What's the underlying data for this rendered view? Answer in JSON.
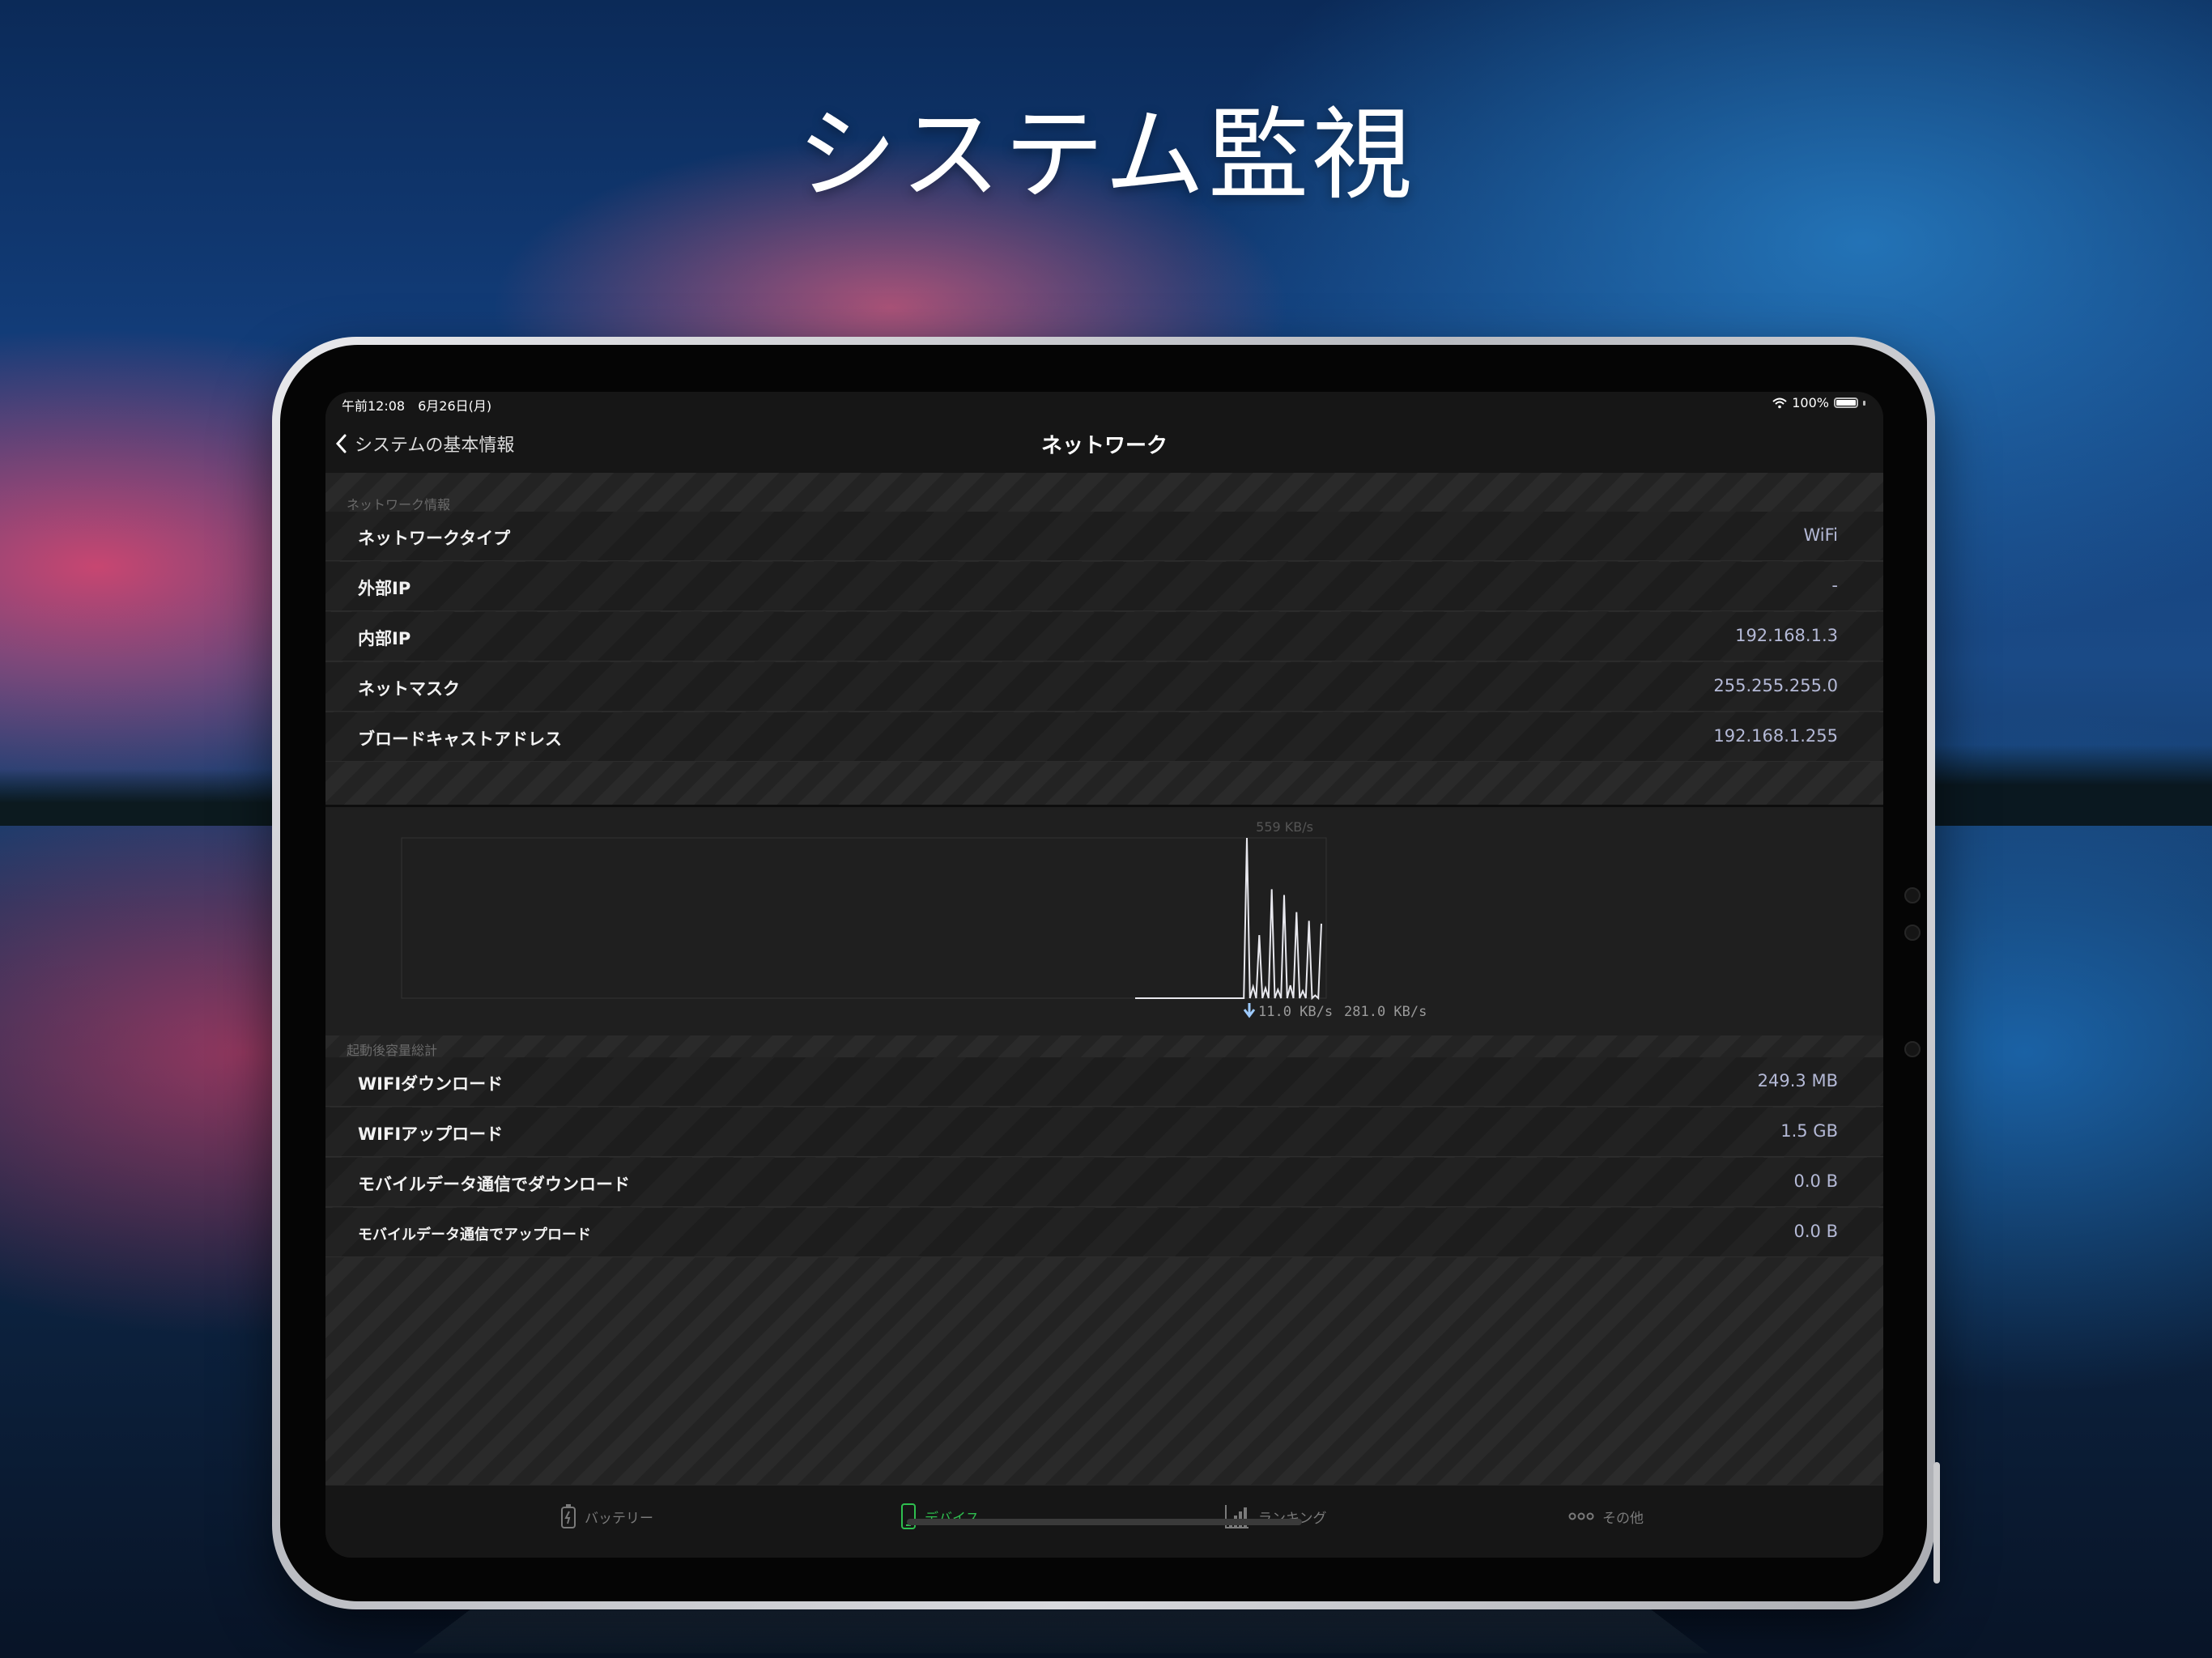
{
  "hero": {
    "title": "システム監視"
  },
  "status_bar": {
    "time": "午前12:08　6月26日(月)",
    "battery": "100%"
  },
  "nav": {
    "back_label": "システムの基本情報",
    "title": "ネットワーク"
  },
  "network_info": {
    "header": "ネットワーク情報",
    "rows": [
      {
        "label": "ネットワークタイプ",
        "value": "WiFi"
      },
      {
        "label": "外部IP",
        "value": "-"
      },
      {
        "label": "内部IP",
        "value": "192.168.1.3"
      },
      {
        "label": "ネットマスク",
        "value": "255.255.255.0"
      },
      {
        "label": "ブロードキャストアドレス",
        "value": "192.168.1.255"
      }
    ]
  },
  "traffic_graph": {
    "max_label": "559 KB/s",
    "download_label": "11.0 KB/s",
    "upload_label": "281.0 KB/s"
  },
  "chart_data": {
    "type": "line",
    "ylim": [
      0,
      559
    ],
    "series": [
      {
        "name": "",
        "values": [
          0,
          0,
          0,
          0,
          0,
          0,
          0,
          0,
          0,
          0,
          0,
          0,
          0,
          0,
          0,
          0,
          0,
          0,
          0,
          0,
          0,
          0,
          0,
          0,
          0,
          0,
          0,
          0,
          0,
          0,
          0,
          0,
          0,
          0,
          0,
          0,
          559,
          0,
          40,
          0,
          220,
          0,
          35,
          0,
          380,
          0,
          30,
          0,
          360,
          0,
          45,
          0,
          300,
          0,
          25,
          0,
          270,
          0,
          10,
          0,
          260
        ]
      }
    ]
  },
  "usage_totals": {
    "header": "起動後容量総計",
    "rows": [
      {
        "label": "WIFIダウンロード",
        "value": "249.3 MB"
      },
      {
        "label": "WIFIアップロード",
        "value": "1.5 GB"
      },
      {
        "label": "モバイルデータ通信でダウンロード",
        "value": "0.0 B"
      },
      {
        "label": "モバイルデータ通信でアップロード",
        "value": "0.0 B"
      }
    ]
  },
  "tab_bar": {
    "items": [
      {
        "label": "バッテリー",
        "icon": "battery-icon"
      },
      {
        "label": "デバイス",
        "icon": "phone-icon"
      },
      {
        "label": "ランキング",
        "icon": "bar-chart-icon"
      },
      {
        "label": "その他",
        "icon": "more-dots-icon"
      }
    ],
    "active_index": 1,
    "active_color": "#2fbf4f"
  }
}
